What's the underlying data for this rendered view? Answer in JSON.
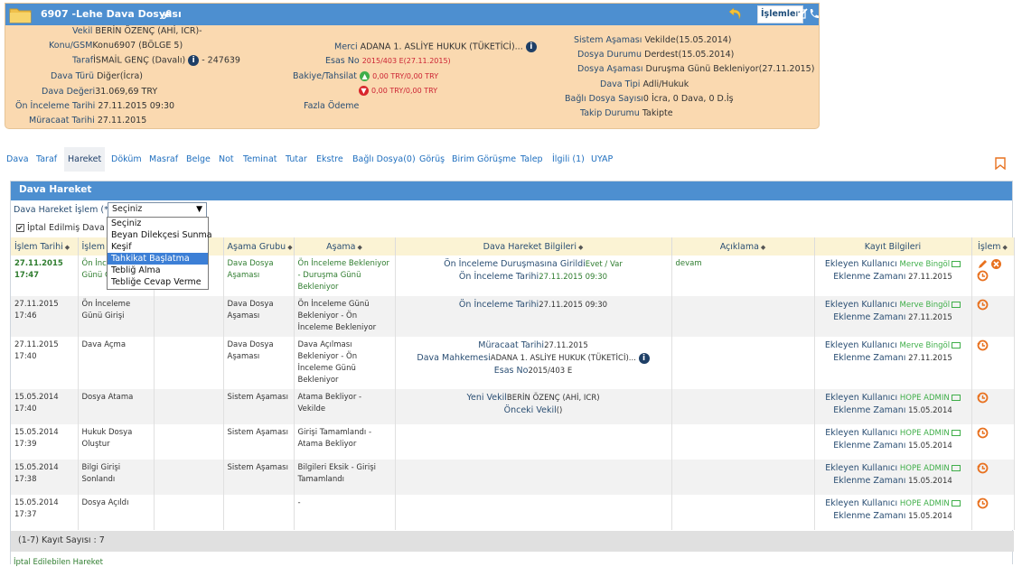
{
  "header": {
    "title": "6907 -Lehe Dava Dosyası",
    "islemler_label": "İşlemler",
    "left": [
      {
        "label": "Vekil",
        "value": "BERİN ÖZENÇ (AHİ, ICR)-"
      },
      {
        "label": "Konu/GSM",
        "value": "Konu6907 (BÖLGE 5)"
      },
      {
        "label": "Taraf",
        "value": "İSMAİL GENÇ (Davalı)",
        "extra": "- 247639"
      },
      {
        "label": "Dava Türü",
        "value": "Diğer(İcra)"
      },
      {
        "label": "Dava Değeri",
        "value": "31.069,69 TRY"
      },
      {
        "label": "Ön İnceleme Tarihi",
        "value": "27.11.2015 09:30"
      },
      {
        "label": "Müracaat Tarihi",
        "value": "27.11.2015"
      }
    ],
    "middle": {
      "merci_label": "Merci",
      "merci_value": "ADANA 1. ASLİYE HUKUK (TÜKETİCİ)...",
      "esas_label": "Esas No",
      "esas_value": "2015/403 E(27.11.2015)",
      "bakiye_label": "Bakiye/Tahsilat",
      "bakiye_up": "0,00 TRY/0,00 TRY",
      "bakiye_down": "0,00 TRY/0,00 TRY",
      "fazla_label": "Fazla Ödeme"
    },
    "right": [
      {
        "label": "Sistem Aşaması",
        "value": "Vekilde(15.05.2014)"
      },
      {
        "label": "Dosya Durumu",
        "value": "Derdest(15.05.2014)"
      },
      {
        "label": "Dosya Aşaması",
        "value": "Duruşma Günü Bekleniyor(27.11.2015)"
      },
      {
        "label": "Dava Tipi",
        "value": "Adli/Hukuk"
      },
      {
        "label": "Bağlı Dosya Sayısı",
        "value": "0 İcra, 0 Dava, 0 D.İş"
      },
      {
        "label": "Takip Durumu",
        "value": "Takipte"
      }
    ]
  },
  "tabs": [
    {
      "label": "Dava"
    },
    {
      "label": "Taraf"
    },
    {
      "label": "Hareket",
      "active": true
    },
    {
      "label": "Döküm"
    },
    {
      "label": "Masraf"
    },
    {
      "label": "Belge"
    },
    {
      "label": "Not"
    },
    {
      "label": "Teminat"
    },
    {
      "label": "Tutar"
    },
    {
      "label": "Ekstre"
    },
    {
      "label": "Bağlı Dosya(0)"
    },
    {
      "label": "Görüş"
    },
    {
      "label": "Birim Görüşme"
    },
    {
      "label": "Talep"
    },
    {
      "label": "İlgili (1)"
    },
    {
      "label": "UYAP"
    }
  ],
  "panel": {
    "title": "Dava Hareket",
    "op_label": "Dava Hareket İşlem (*)",
    "op_selected": "Seçiniz",
    "iptal_label": "İptal Edilmiş Dava Hareketlerini Göster",
    "dropdown_options": [
      "Seçiniz",
      "Beyan Dilekçesi Sunma",
      "Keşif",
      "Tahkikat Başlatma",
      "Tebliğ Alma",
      "Tebliğe Cevap Verme"
    ],
    "dropdown_selected_index": 3,
    "footer": "(1-7) Kayıt Sayısı : 7",
    "cancelled_link": "İptal Edilebilen Hareket"
  },
  "table": {
    "headers": [
      "İşlem Tarihi",
      "İşlem",
      "",
      "Aşama Grubu",
      "Aşama",
      "Dava Hareket Bilgileri",
      "Açıklama",
      "Kayıt Bilgileri",
      "İşlem"
    ],
    "kayit_labels": {
      "user": "Ekleyen Kullanıcı",
      "date": "Eklenme Zamanı"
    },
    "rows": [
      {
        "date": "27.11.2015",
        "time": "17:47",
        "islem": "Ön İnceleme Günü Girildi",
        "col3": "",
        "grup": "Dava Dosya Aşaması",
        "asama": "Ön İnceleme Bekleniyor - Duruşma Günü Bekleniyor",
        "info": [
          {
            "label": "Ön İnceleme Duruşmasına Girildi",
            "value": "Evet / Var"
          },
          {
            "label": "Ön İnceleme Tarihi",
            "value": "27.11.2015 09:30"
          }
        ],
        "aciklama": "devam",
        "user": "Merve Bingöl",
        "added": "27.11.2015",
        "green": true,
        "edit": true
      },
      {
        "date": "27.11.2015",
        "time": "17:46",
        "islem": "Ön İnceleme Günü Girişi",
        "col3": "",
        "grup": "Dava Dosya Aşaması",
        "asama": "Ön İnceleme Günü Bekleniyor - Ön İnceleme Bekleniyor",
        "info": [
          {
            "label": "Ön İnceleme Tarihi",
            "value": "27.11.2015 09:30"
          }
        ],
        "aciklama": "",
        "user": "Merve Bingöl",
        "added": "27.11.2015",
        "green": false,
        "edit": false
      },
      {
        "date": "27.11.2015",
        "time": "17:40",
        "islem": "Dava Açma",
        "col3": "",
        "grup": "Dava Dosya Aşaması",
        "asama": "Dava Açılması Bekleniyor - Ön İnceleme Günü Bekleniyor",
        "info": [
          {
            "label": "Müracaat Tarihi",
            "value": "27.11.2015"
          },
          {
            "label": "Dava Mahkemesi",
            "value": "ADANA 1. ASLİYE HUKUK (TÜKETİCİ)...",
            "infoicon": true
          },
          {
            "label": "Esas No",
            "value": "2015/403 E"
          }
        ],
        "aciklama": "",
        "user": "Merve Bingöl",
        "added": "27.11.2015",
        "green": false,
        "edit": false
      },
      {
        "date": "15.05.2014",
        "time": "17:40",
        "islem": "Dosya Atama",
        "col3": "",
        "grup": "Sistem Aşaması",
        "asama": "Atama Bekliyor - Vekilde",
        "info": [
          {
            "label": "Yeni Vekil",
            "value": "BERİN ÖZENÇ (AHİ, ICR)"
          },
          {
            "label": "Önceki Vekil",
            "value": "()"
          }
        ],
        "aciklama": "",
        "user": "HOPE ADMIN",
        "added": "15.05.2014",
        "green": false,
        "edit": false
      },
      {
        "date": "15.05.2014",
        "time": "17:39",
        "islem": "Hukuk Dosya Oluştur",
        "col3": "",
        "grup": "Sistem Aşaması",
        "asama": "Girişi Tamamlandı - Atama Bekliyor",
        "info": [],
        "aciklama": "",
        "user": "HOPE ADMIN",
        "added": "15.05.2014",
        "green": false,
        "edit": false
      },
      {
        "date": "15.05.2014",
        "time": "17:38",
        "islem": "Bilgi Girişi Sonlandı",
        "col3": "",
        "grup": "Sistem Aşaması",
        "asama": "Bilgileri Eksik - Girişi Tamamlandı",
        "info": [],
        "aciklama": "",
        "user": "HOPE ADMIN",
        "added": "15.05.2014",
        "green": false,
        "edit": false
      },
      {
        "date": "15.05.2014",
        "time": "17:37",
        "islem": "Dosya Açıldı",
        "col3": "",
        "grup": "",
        "asama": "-",
        "info": [],
        "aciklama": "",
        "user": "HOPE ADMIN",
        "added": "15.05.2014",
        "green": false,
        "edit": false
      }
    ]
  },
  "colors": {
    "header_blue": "#4d8fd0",
    "header_bg": "#fad9b0",
    "link_blue": "#1f6fbf",
    "green": "#2f7d2f",
    "orange": "#e8711f",
    "red": "#cc2233"
  }
}
